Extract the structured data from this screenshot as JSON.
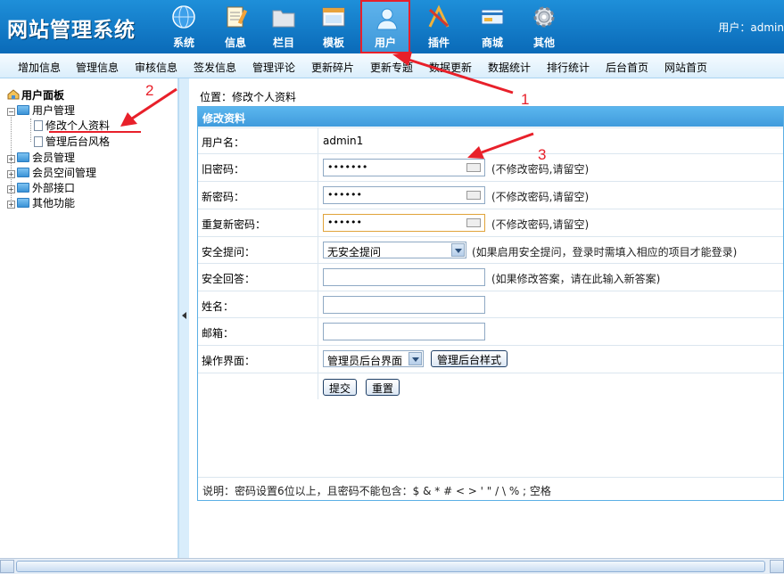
{
  "header": {
    "logo": "网站管理系统",
    "user_label": "用户：admin",
    "nav": [
      {
        "label": "系统",
        "icon": "globe-icon",
        "active": false
      },
      {
        "label": "信息",
        "icon": "notepad-icon",
        "active": false
      },
      {
        "label": "栏目",
        "icon": "folder-icon",
        "active": false
      },
      {
        "label": "模板",
        "icon": "window-icon",
        "active": false
      },
      {
        "label": "用户",
        "icon": "user-icon",
        "active": true
      },
      {
        "label": "插件",
        "icon": "tools-icon",
        "active": false
      },
      {
        "label": "商城",
        "icon": "card-icon",
        "active": false
      },
      {
        "label": "其他",
        "icon": "gear-icon",
        "active": false
      }
    ]
  },
  "subnav": [
    "增加信息",
    "管理信息",
    "审核信息",
    "签发信息",
    "管理评论",
    "更新碎片",
    "更新专题",
    "数据更新",
    "数据统计",
    "排行统计",
    "后台首页",
    "网站首页"
  ],
  "sidebar": {
    "title": "用户面板",
    "tree": [
      {
        "label": "用户管理",
        "expanded": true
      },
      {
        "label": "修改个人资料"
      },
      {
        "label": "管理后台风格"
      },
      {
        "label": "会员管理",
        "expanded": false
      },
      {
        "label": "会员空间管理",
        "expanded": false
      },
      {
        "label": "外部接口",
        "expanded": false
      },
      {
        "label": "其他功能",
        "expanded": false
      }
    ]
  },
  "main": {
    "breadcrumb": "位置：修改个人资料",
    "form_title": "修改资料",
    "fields": {
      "username_label": "用户名：",
      "username_value": "admin1",
      "old_pw_label": "旧密码：",
      "old_pw_value": "•••••••",
      "old_pw_hint": "(不修改密码,请留空)",
      "new_pw_label": "新密码：",
      "new_pw_value": "••••••",
      "new_pw_hint": "(不修改密码,请留空)",
      "repeat_pw_label": "重复新密码：",
      "repeat_pw_value": "••••••",
      "repeat_pw_hint": "(不修改密码,请留空)",
      "question_label": "安全提问：",
      "question_value": "无安全提问",
      "question_hint": "(如果启用安全提问，登录时需填入相应的项目才能登录)",
      "answer_label": "安全回答：",
      "answer_hint": "(如果修改答案，请在此输入新答案)",
      "name_label": "姓名：",
      "email_label": "邮箱：",
      "ui_label": "操作界面：",
      "ui_value": "管理员后台界面",
      "ui_style_button": "管理后台样式",
      "submit_button": "提交",
      "reset_button": "重置"
    },
    "note": "说明：密码设置6位以上，且密码不能包含：$ & * # < > ' \" / \\ % ; 空格"
  },
  "annotations": [
    "1",
    "2",
    "3"
  ],
  "colors": {
    "accent_red": "#e8202a",
    "header_blue": "#1e8fd9",
    "form_head": "#4aa8e6"
  }
}
